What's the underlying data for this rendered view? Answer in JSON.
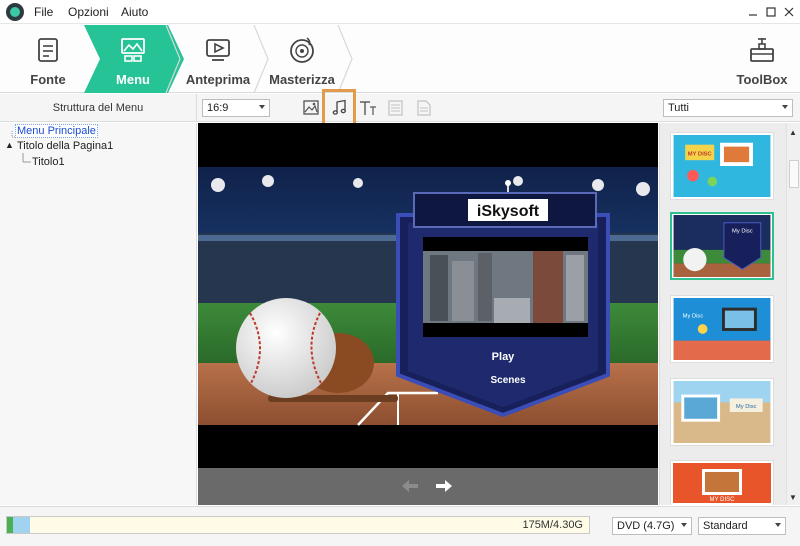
{
  "menubar": {
    "items": [
      "File",
      "Opzioni",
      "Aiuto"
    ],
    "window_controls": [
      "minimize-icon",
      "maximize-icon",
      "close-icon"
    ]
  },
  "steps": [
    {
      "label": "Fonte",
      "icon": "document-icon",
      "active": false
    },
    {
      "label": "Menu",
      "icon": "menu-layout-icon",
      "active": true
    },
    {
      "label": "Anteprima",
      "icon": "play-screen-icon",
      "active": false
    },
    {
      "label": "Masterizza",
      "icon": "disc-burn-icon",
      "active": false
    }
  ],
  "toolbox": {
    "label": "ToolBox",
    "icon": "toolbox-icon"
  },
  "left_panel": {
    "title": "Struttura del Menu",
    "tree": [
      {
        "label": "Menu Principale",
        "level": 0,
        "selected": true
      },
      {
        "label": "Titolo della Pagina1",
        "level": 0,
        "selected": false,
        "expanded": true
      },
      {
        "label": "Titolo1",
        "level": 1,
        "selected": false
      }
    ]
  },
  "toolbar": {
    "aspect_ratio": "16:9",
    "tools": [
      {
        "name": "background-image-icon",
        "highlighted": false,
        "enabled": true
      },
      {
        "name": "music-note-icon",
        "highlighted": true,
        "enabled": true
      },
      {
        "name": "text-icon",
        "highlighted": false,
        "enabled": true
      },
      {
        "name": "chapter-icon",
        "highlighted": false,
        "enabled": false
      },
      {
        "name": "page-icon",
        "highlighted": false,
        "enabled": false
      }
    ]
  },
  "preview": {
    "logo_text": "iSkysoft",
    "buttons": [
      "Play",
      "Scenes"
    ]
  },
  "templates": {
    "filter": "Tutti",
    "selected_index": 1,
    "items": [
      {
        "caption": "MY DISC",
        "theme": "kids"
      },
      {
        "caption": "My Disc",
        "theme": "baseball"
      },
      {
        "caption": "My Disc",
        "theme": "underwater"
      },
      {
        "caption": "My Disc",
        "theme": "beach"
      },
      {
        "caption": "MY DISC",
        "theme": "autumn"
      }
    ]
  },
  "status": {
    "usage_text": "175M/4.30G",
    "usage_fraction": 0.04,
    "disc_type": "DVD (4.7G)",
    "quality": "Standard"
  },
  "colors": {
    "accent": "#25c395",
    "highlight_border": "#e39a4c",
    "progress_fill": "#9fd3f0"
  }
}
